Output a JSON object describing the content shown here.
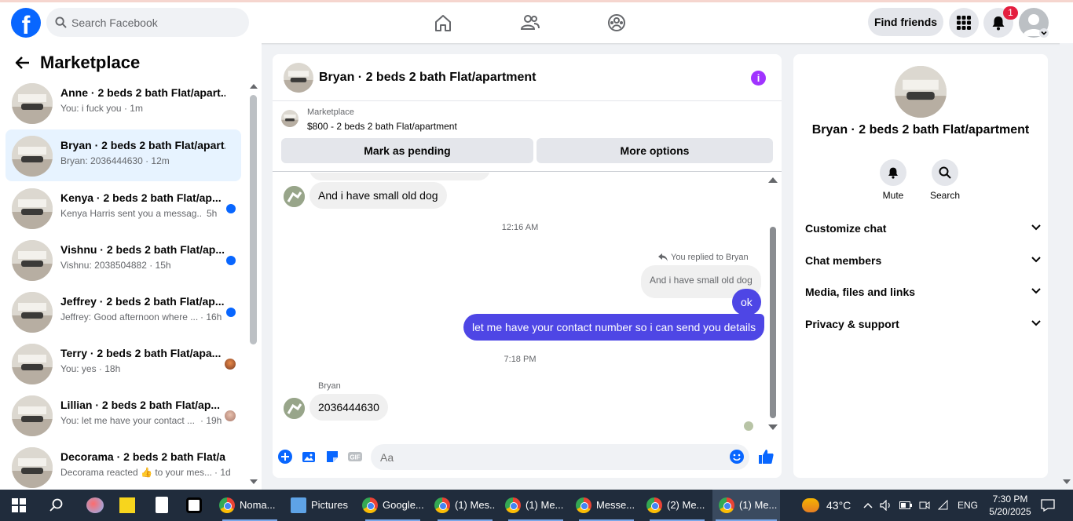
{
  "topbar": {
    "logo": "f",
    "search_placeholder": "Search Facebook",
    "find_friends": "Find friends",
    "notif_count": "1"
  },
  "sidebar": {
    "title": "Marketplace",
    "conversations": [
      {
        "name": "Anne · 2 beds 2 bath Flat/apart...",
        "preview": "You: i fuck you · 1m",
        "unread": false
      },
      {
        "name": "Bryan · 2 beds 2 bath Flat/apart...",
        "preview": "Bryan: 2036444630 · 12m",
        "unread": false,
        "active": true
      },
      {
        "name": "Kenya · 2 beds 2 bath Flat/ap...",
        "preview": "Kenya Harris sent you a messag...",
        "time": "5h",
        "unread": true
      },
      {
        "name": "Vishnu · 2 beds 2 bath Flat/ap...",
        "preview": "Vishnu: 2038504882 · 15h",
        "unread": true
      },
      {
        "name": "Jeffrey · 2 beds 2 bath Flat/ap...",
        "preview": "Jeffrey: Good afternoon where ...",
        "time": "· 16h",
        "unread": true
      },
      {
        "name": "Terry · 2 beds 2 bath Flat/apa...",
        "preview": "You: yes · 18h",
        "unread": false
      },
      {
        "name": "Lillian · 2 beds 2 bath Flat/ap...",
        "preview": "You: let me have your contact ...",
        "time": "· 19h",
        "unread": false
      },
      {
        "name": "Decorama · 2 beds 2 bath Flat/a...",
        "preview": "Decorama reacted 👍 to your mes...",
        "time": "· 1d",
        "unread": false
      }
    ]
  },
  "chat": {
    "title": "Bryan · 2 beds 2 bath Flat/apartment",
    "info_icon": "i",
    "marketplace_label": "Marketplace",
    "listing": "$800 - 2 beds 2 bath Flat/apartment",
    "mark_pending": "Mark as pending",
    "more_options": "More options",
    "messages": {
      "m1": "And i have small old dog",
      "time1": "12:16 AM",
      "replied_label": "You replied to Bryan",
      "quoted": "And i have small old dog",
      "m2": "ok",
      "m3": "let me have your contact number so i can send you details",
      "time2": "7:18 PM",
      "sender": "Bryan",
      "m4": "2036444630"
    },
    "composer_placeholder": "Aa"
  },
  "right": {
    "name": "Bryan · 2 beds 2 bath Flat/apartment",
    "mute": "Mute",
    "search": "Search",
    "sections": [
      "Customize chat",
      "Chat members",
      "Media, files and links",
      "Privacy & support"
    ]
  },
  "taskbar": {
    "items": [
      "Noma...",
      "Pictures",
      "Google...",
      "(1) Mes...",
      "(1) Me...",
      "Messe...",
      "(2) Me...",
      "(1) Me..."
    ],
    "weather": "43°C",
    "lang": "ENG",
    "time": "7:30 PM",
    "date": "5/20/2025"
  },
  "colors": {
    "brand": "#0866ff",
    "outgoing": "#4e46e5",
    "info": "#a033ff",
    "active_row": "#e7f3ff"
  }
}
